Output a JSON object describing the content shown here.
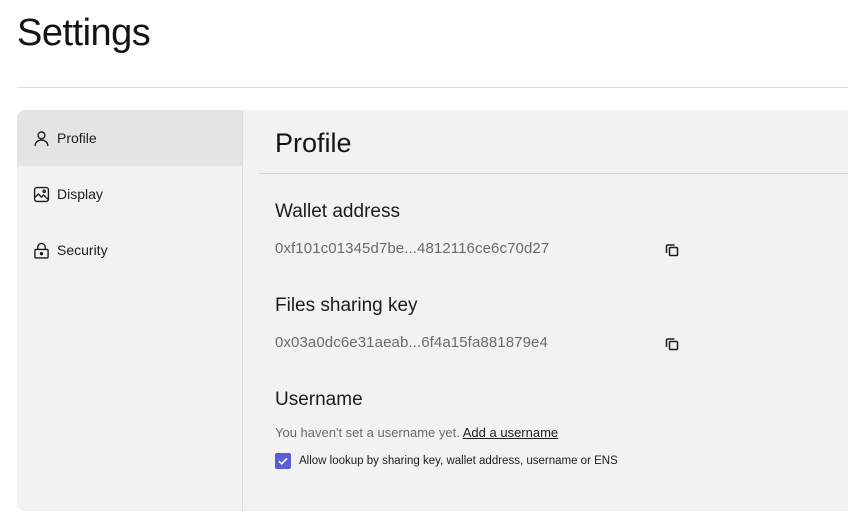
{
  "page": {
    "title": "Settings"
  },
  "sidebar": {
    "items": [
      {
        "label": "Profile",
        "icon": "user-icon",
        "active": true
      },
      {
        "label": "Display",
        "icon": "image-icon",
        "active": false
      },
      {
        "label": "Security",
        "icon": "lock-icon",
        "active": false
      }
    ]
  },
  "profile": {
    "title": "Profile",
    "wallet": {
      "label": "Wallet address",
      "value": "0xf101c01345d7be...4812116ce6c70d27",
      "copy_icon": "copy-icon"
    },
    "sharing_key": {
      "label": "Files sharing key",
      "value": "0x03a0dc6e31aeab...6f4a15fa881879e4",
      "copy_icon": "copy-icon"
    },
    "username": {
      "label": "Username",
      "note": "You haven't set a username yet.",
      "add_link": "Add a username"
    },
    "lookup": {
      "checked": true,
      "label": "Allow lookup by sharing key, wallet address, username or ENS"
    }
  },
  "colors": {
    "accent": "#5a5fd6",
    "panel_bg": "#f2f2f2",
    "active_item_bg": "#e4e4e4"
  }
}
